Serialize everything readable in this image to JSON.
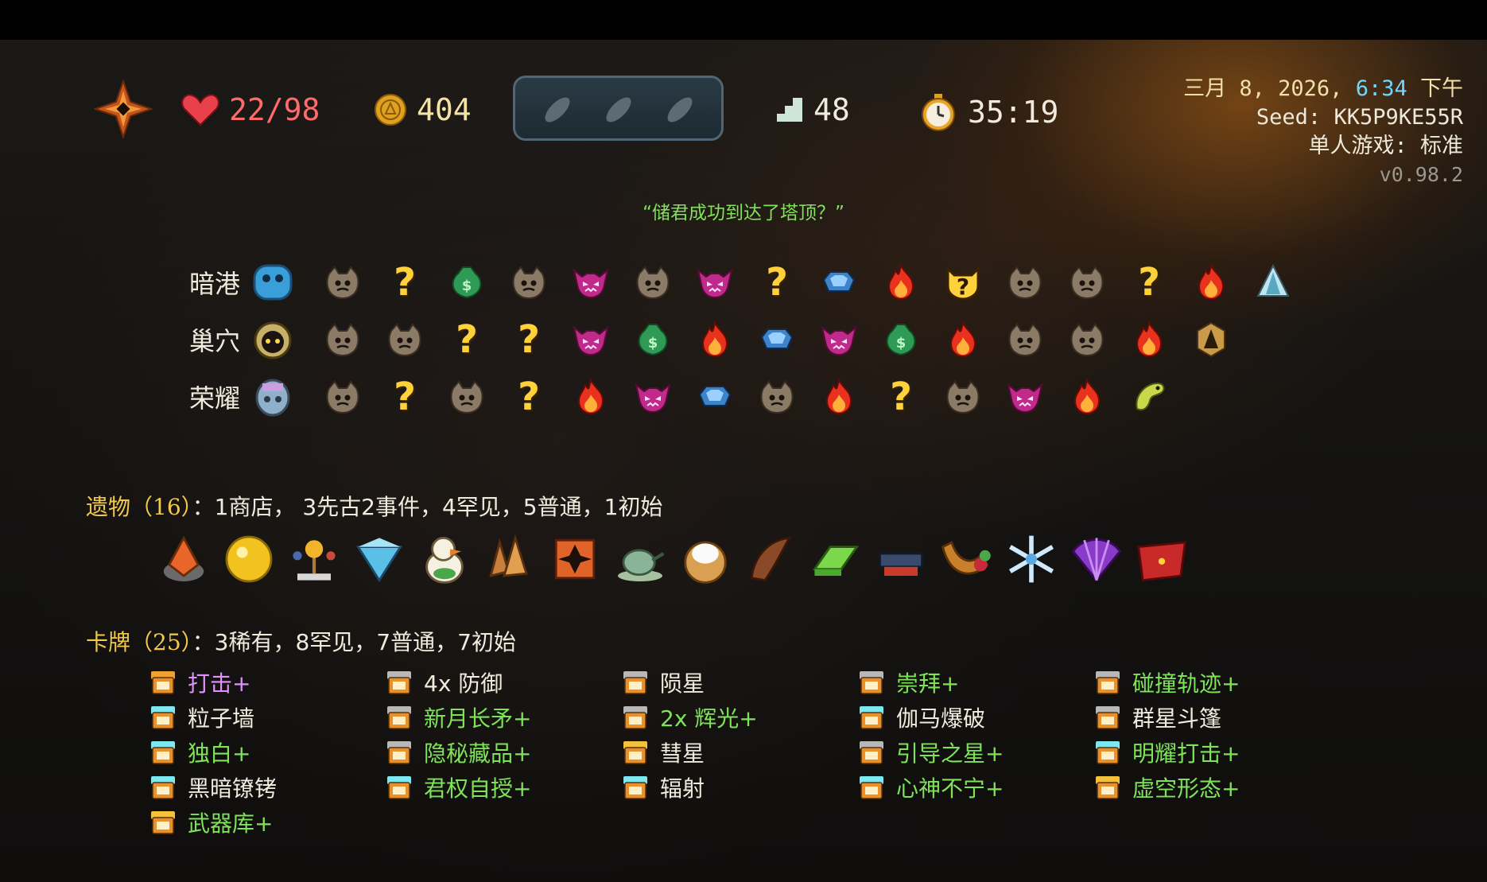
{
  "colors": {
    "hp": "#ff6b6b",
    "upgraded": "#7fe35a",
    "curse_pink": "#e38fff",
    "gold_label": "#f2c94c",
    "time": "#6fd8ff"
  },
  "stats": {
    "hp": "22/98",
    "gold": "404",
    "floor": "48",
    "time": "35:19"
  },
  "potions": [
    "empty-potion",
    "empty-potion",
    "empty-potion"
  ],
  "info": {
    "date_prefix": "三月 8, 2026, ",
    "time": "6:34",
    "date_suffix": " 下午",
    "seed": "Seed: KK5P9KE55R",
    "mode": "单人游戏: 标准",
    "version": "v0.98.2"
  },
  "quote": "“储君成功到达了塔顶？”",
  "acts": [
    {
      "name": "暗港",
      "boss": "blue-slime-boss-icon",
      "nodes": [
        "monster",
        "unknown",
        "treasure",
        "monster",
        "elite",
        "monster",
        "elite",
        "unknown",
        "shop",
        "rest",
        "unknown-boss",
        "monster",
        "monster",
        "unknown",
        "rest",
        "ice-boss"
      ]
    },
    {
      "name": "巢穴",
      "boss": "hooded-boss-icon",
      "nodes": [
        "monster",
        "monster",
        "unknown",
        "unknown",
        "elite",
        "treasure",
        "rest",
        "shop",
        "elite",
        "treasure",
        "rest",
        "monster",
        "monster",
        "rest",
        "ancient"
      ]
    },
    {
      "name": "荣耀",
      "boss": "spirit-boss-icon",
      "nodes": [
        "monster",
        "unknown",
        "monster",
        "unknown",
        "rest",
        "elite",
        "shop",
        "monster",
        "rest",
        "unknown",
        "monster",
        "elite",
        "rest",
        "serpent"
      ]
    }
  ],
  "relics": {
    "label": "遗物（16）",
    "summary": "：1商店， 3先古2事件，4罕见，5普通，1初始",
    "items": [
      "ember-stone",
      "gold-orb",
      "orrery",
      "blue-gem",
      "duck",
      "brown-shards",
      "shuriken",
      "teapot",
      "cream-pie",
      "brown-horn",
      "green-ingot",
      "anvil-tray",
      "cornucopia",
      "snowflake",
      "purple-fan",
      "red-cushion"
    ]
  },
  "cards": {
    "label": "卡牌（25）",
    "summary": "：3稀有，8罕见，7普通，7初始",
    "items": [
      {
        "text": "打击+",
        "color": "pink",
        "icon": "orange"
      },
      {
        "text": "4x 防御",
        "color": "white",
        "icon": "gray"
      },
      {
        "text": "陨星",
        "color": "white",
        "icon": "gray"
      },
      {
        "text": "崇拜+",
        "color": "green",
        "icon": "gray"
      },
      {
        "text": "碰撞轨迹+",
        "color": "green",
        "icon": "gray"
      },
      {
        "text": "粒子墙",
        "color": "white",
        "icon": "cyan"
      },
      {
        "text": "新月长矛+",
        "color": "green",
        "icon": "gray"
      },
      {
        "text": "2x 辉光+",
        "color": "green",
        "icon": "gray"
      },
      {
        "text": "伽马爆破",
        "color": "white",
        "icon": "cyan"
      },
      {
        "text": "群星斗篷",
        "color": "white",
        "icon": "gray"
      },
      {
        "text": "独白+",
        "color": "green",
        "icon": "cyan"
      },
      {
        "text": "隐秘藏品+",
        "color": "green",
        "icon": "gray"
      },
      {
        "text": "彗星",
        "color": "white",
        "icon": "gold"
      },
      {
        "text": "引导之星+",
        "color": "green",
        "icon": "gray"
      },
      {
        "text": "明耀打击+",
        "color": "green",
        "icon": "cyan"
      },
      {
        "text": "黑暗镣铐",
        "color": "white",
        "icon": "cyan"
      },
      {
        "text": "君权自授+",
        "color": "green",
        "icon": "cyan"
      },
      {
        "text": "辐射",
        "color": "white",
        "icon": "cyan"
      },
      {
        "text": "心神不宁+",
        "color": "green",
        "icon": "cyan"
      },
      {
        "text": "虚空形态+",
        "color": "green",
        "icon": "gold"
      },
      {
        "text": "武器库+",
        "color": "green",
        "icon": "gold"
      }
    ]
  }
}
